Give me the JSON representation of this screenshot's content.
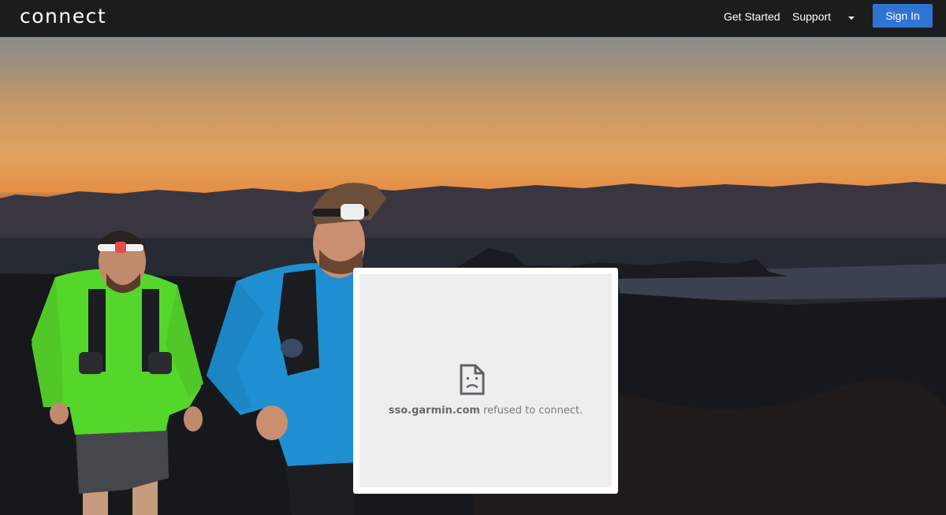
{
  "header": {
    "logo_text": "connect",
    "nav": {
      "get_started": "Get Started",
      "support": "Support"
    },
    "sign_in_label": "Sign In"
  },
  "iframe_error": {
    "icon": "sad-page-icon",
    "host": "sso.garmin.com",
    "message": " refused to connect."
  },
  "colors": {
    "topbar": "#1c1c1d",
    "sign_in_button": "#2f73d3",
    "error_panel": "#eeeeee"
  }
}
